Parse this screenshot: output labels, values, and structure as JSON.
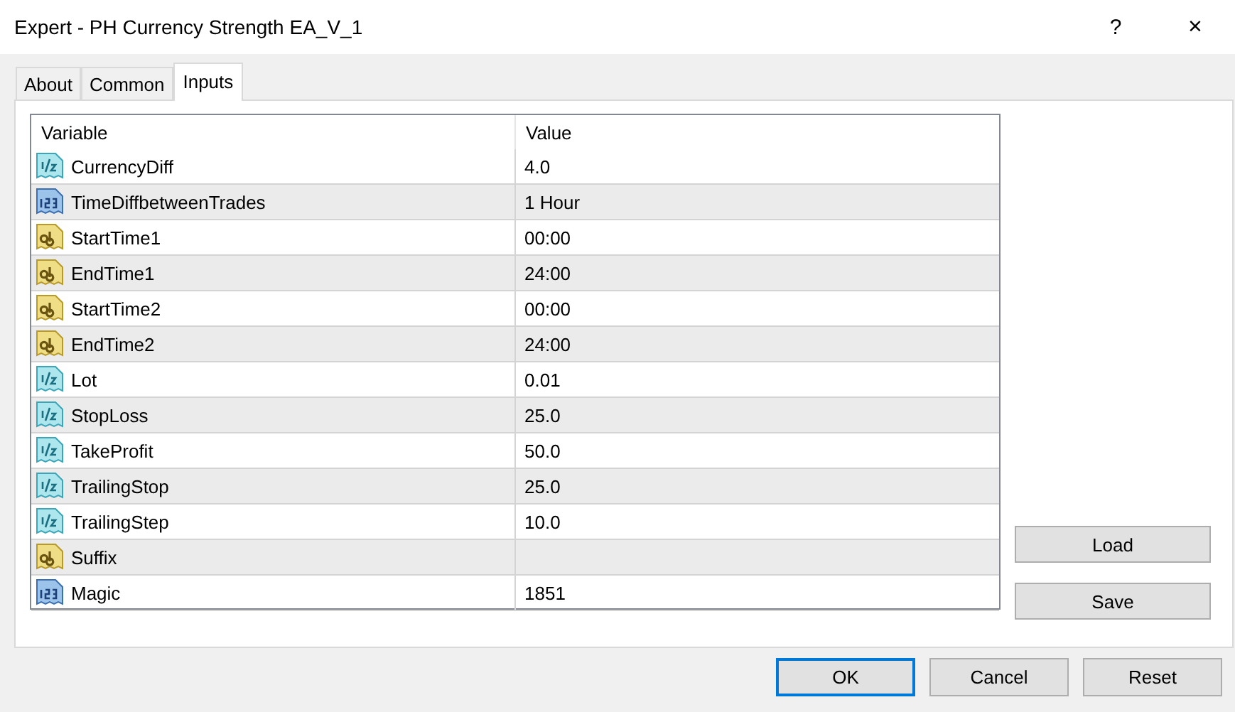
{
  "window": {
    "title": "Expert - PH Currency Strength EA_V_1",
    "help": "?",
    "close": "×"
  },
  "tabs": [
    {
      "label": "About",
      "selected": false
    },
    {
      "label": "Common",
      "selected": false
    },
    {
      "label": "Inputs",
      "selected": true
    }
  ],
  "table": {
    "columns": [
      "Variable",
      "Value"
    ],
    "rows": [
      {
        "kind": "double",
        "name": "CurrencyDiff",
        "value": "4.0"
      },
      {
        "kind": "int",
        "name": "TimeDiffbetweenTrades",
        "value": "1 Hour"
      },
      {
        "kind": "string",
        "name": "StartTime1",
        "value": "00:00"
      },
      {
        "kind": "string",
        "name": "EndTime1",
        "value": "24:00"
      },
      {
        "kind": "string",
        "name": "StartTime2",
        "value": "00:00"
      },
      {
        "kind": "string",
        "name": "EndTime2",
        "value": "24:00"
      },
      {
        "kind": "double",
        "name": "Lot",
        "value": "0.01"
      },
      {
        "kind": "double",
        "name": "StopLoss",
        "value": "25.0"
      },
      {
        "kind": "double",
        "name": "TakeProfit",
        "value": "50.0"
      },
      {
        "kind": "double",
        "name": "TrailingStop",
        "value": "25.0"
      },
      {
        "kind": "double",
        "name": "TrailingStep",
        "value": "10.0"
      },
      {
        "kind": "string",
        "name": "Suffix"
      },
      {
        "kind": "int",
        "name": "Magic",
        "value": "1851"
      }
    ]
  },
  "side_buttons": [
    "Load",
    "Save"
  ],
  "buttons": [
    {
      "label": "OK",
      "default": true
    },
    {
      "label": "Cancel",
      "default": false
    },
    {
      "label": "Reset",
      "default": false
    }
  ]
}
